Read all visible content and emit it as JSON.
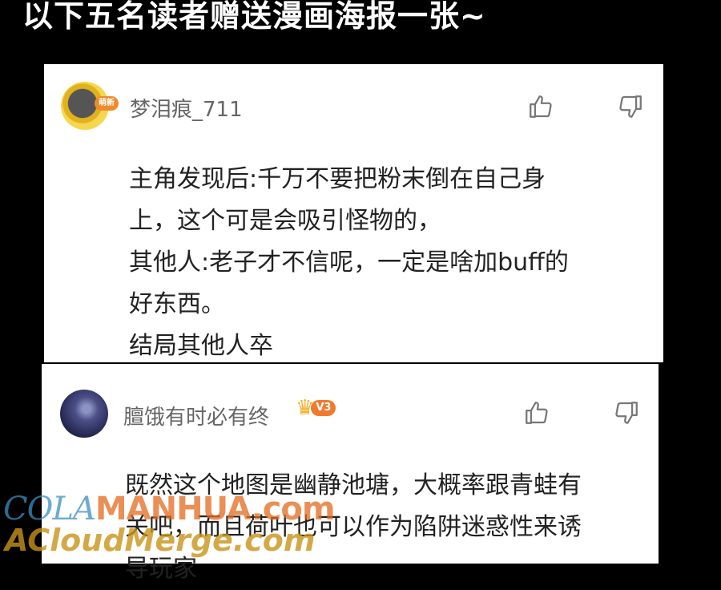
{
  "banner": {
    "text": "以下五名读者赠送漫画海报一张~"
  },
  "comments": [
    {
      "username": "梦泪痕_711",
      "avatar_badge": "萌新",
      "lines": [
        "主角发现后:千万不要把粉末倒在自己身",
        "上，这个可是会吸引怪物的，",
        "其他人:老子才不信呢，一定是啥加buff的",
        "好东西。",
        "结局其他人卒"
      ]
    },
    {
      "username": "膻饿有时必有终",
      "vip_level": "V3",
      "lines": [
        "既然这个地图是幽静池塘，大概率跟青蛙有",
        "关吧，而且荷叶也可以作为陷阱迷惑性来诱",
        "导玩家"
      ]
    }
  ],
  "watermarks": {
    "line1_a": "COLA",
    "line1_b": "MANHUA.com",
    "line2": "ACloudMerge.com"
  },
  "icons": [
    "thumbs-up-icon",
    "thumbs-down-icon",
    "crown-icon"
  ]
}
